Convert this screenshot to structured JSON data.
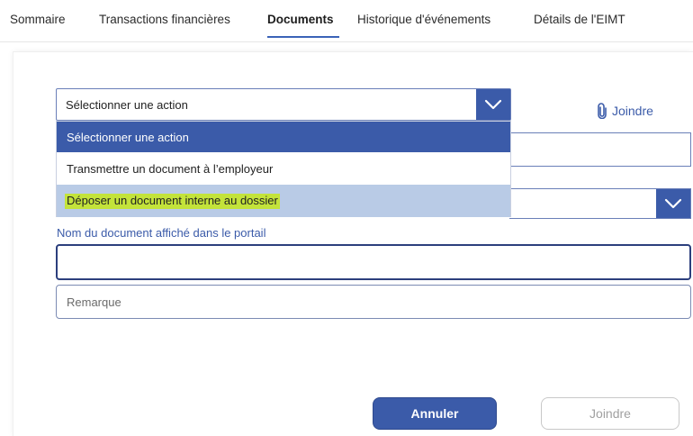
{
  "tabs": {
    "summary": "Sommaire",
    "transactions": "Transactions financières",
    "documents": "Documents",
    "history": "Historique d'événements",
    "details": "Détails de l'EIMT",
    "active": "Documents"
  },
  "action_select": {
    "value": "Sélectionner une action",
    "options": [
      "Sélectionner une action",
      "Transmettre un document à l’employeur",
      "Déposer un document interne au dossier"
    ],
    "highlighted_option_index": 2
  },
  "attach_link": {
    "label": "Joindre",
    "icon": "paperclip-icon"
  },
  "document_name": {
    "label": "Nom du document affiché dans le portail",
    "value": ""
  },
  "remark": {
    "placeholder": "Remarque"
  },
  "buttons": {
    "cancel": "Annuler",
    "join": "Joindre"
  },
  "colors": {
    "accent": "#3b5ba9",
    "highlight": "#c3e33a",
    "hover_option": "#b9cbe6"
  }
}
